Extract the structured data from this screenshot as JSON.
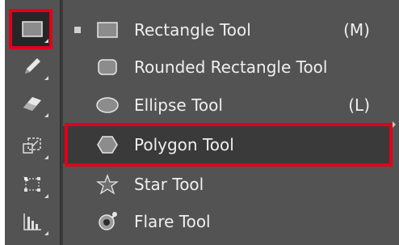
{
  "toolbar": {
    "tools": [
      {
        "name": "rectangle-tool-icon",
        "active": true
      },
      {
        "name": "pencil-tool-icon",
        "active": false
      },
      {
        "name": "eraser-tool-icon",
        "active": false
      },
      {
        "name": "scale-tool-icon",
        "active": false
      },
      {
        "name": "free-transform-tool-icon",
        "active": false
      },
      {
        "name": "graph-tool-icon",
        "active": false
      }
    ]
  },
  "menu": {
    "items": [
      {
        "label": "Rectangle Tool",
        "shortcut": "(M)",
        "icon": "rectangle-icon",
        "checked": true
      },
      {
        "label": "Rounded Rectangle Tool",
        "shortcut": "",
        "icon": "rounded-rectangle-icon",
        "checked": false
      },
      {
        "label": "Ellipse Tool",
        "shortcut": "(L)",
        "icon": "ellipse-icon",
        "checked": false
      },
      {
        "label": "Polygon Tool",
        "shortcut": "",
        "icon": "polygon-icon",
        "checked": false,
        "highlighted": true
      },
      {
        "label": "Star Tool",
        "shortcut": "",
        "icon": "star-icon",
        "checked": false
      },
      {
        "label": "Flare Tool",
        "shortcut": "",
        "icon": "flare-icon",
        "checked": false
      }
    ]
  },
  "colors": {
    "highlight_border": "#e0001b",
    "panel": "#535353",
    "text": "#efefef"
  }
}
